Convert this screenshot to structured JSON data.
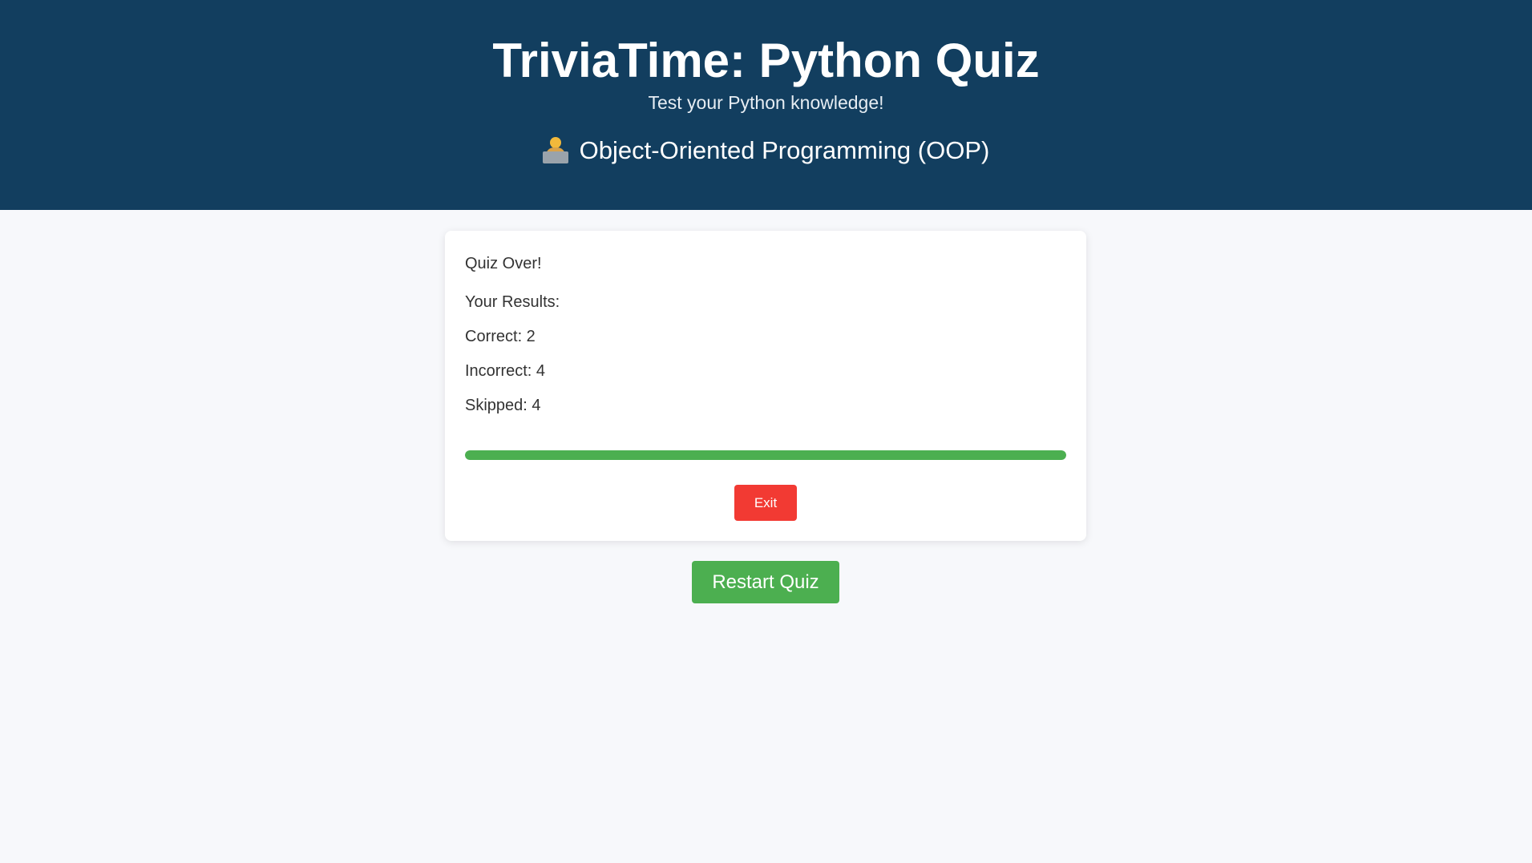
{
  "header": {
    "title": "TriviaTime: Python Quiz",
    "subtitle": "Test your Python knowledge!",
    "topic_icon": "technologist-emoji",
    "topic": "Object-Oriented Programming (OOP)"
  },
  "results": {
    "heading": "Quiz Over!",
    "subheading": "Your Results:",
    "correct": "Correct: 2",
    "incorrect": "Incorrect: 4",
    "skipped": "Skipped: 4",
    "progress_fraction": 1.0
  },
  "buttons": {
    "exit_label": "Exit",
    "restart_label": "Restart Quiz"
  },
  "colors": {
    "header_bg": "#123e5f",
    "page_bg": "#f7f8fb",
    "progress": "#4caf50",
    "exit": "#f23a33",
    "restart": "#4caf50"
  }
}
